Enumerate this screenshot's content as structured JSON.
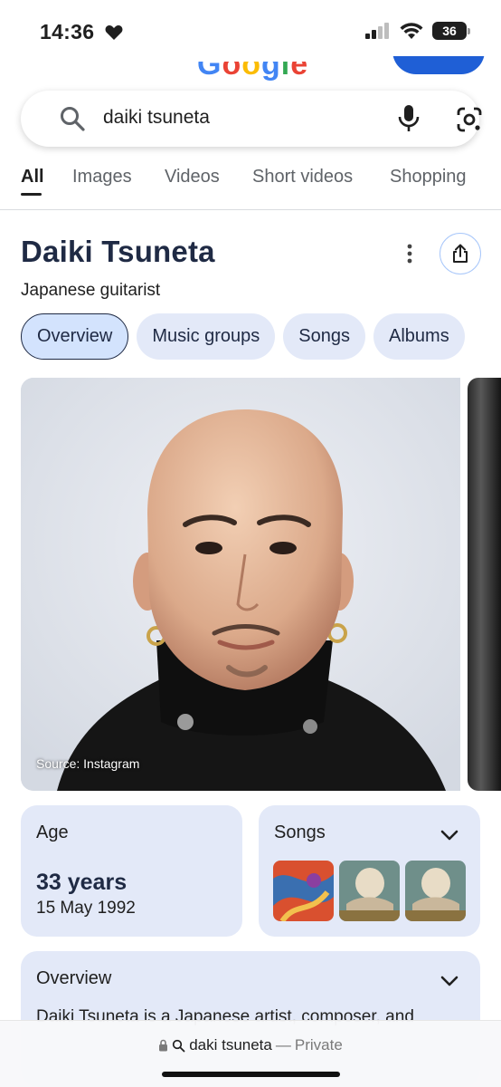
{
  "status_bar": {
    "time": "14:36",
    "battery": "36"
  },
  "header": {
    "logo_text": "Google"
  },
  "search": {
    "query": "daiki tsuneta"
  },
  "tabs": [
    {
      "label": "All",
      "active": true
    },
    {
      "label": "Images",
      "active": false
    },
    {
      "label": "Videos",
      "active": false
    },
    {
      "label": "Short videos",
      "active": false
    },
    {
      "label": "Shopping",
      "active": false
    }
  ],
  "knowledge_panel": {
    "title": "Daiki Tsuneta",
    "subtitle": "Japanese guitarist",
    "chips": [
      {
        "label": "Overview",
        "active": true
      },
      {
        "label": "Music groups",
        "active": false
      },
      {
        "label": "Songs",
        "active": false
      },
      {
        "label": "Albums",
        "active": false
      }
    ],
    "photo_source": "Source: Instagram",
    "age": {
      "label": "Age",
      "value": "33 years",
      "birth_date": "15 May 1992"
    },
    "songs": {
      "label": "Songs"
    },
    "overview": {
      "label": "Overview",
      "text": "Daiki Tsuneta is a Japanese artist, composer, and"
    }
  },
  "bottom_bar": {
    "query": "daki tsuneta",
    "separator": "—",
    "private_label": "Private"
  },
  "colors": {
    "accent_blue": "#1f5fd6",
    "chip_bg": "#e3e9f8",
    "chip_active_bg": "#d3e3fd",
    "title_navy": "#1f2a44"
  }
}
